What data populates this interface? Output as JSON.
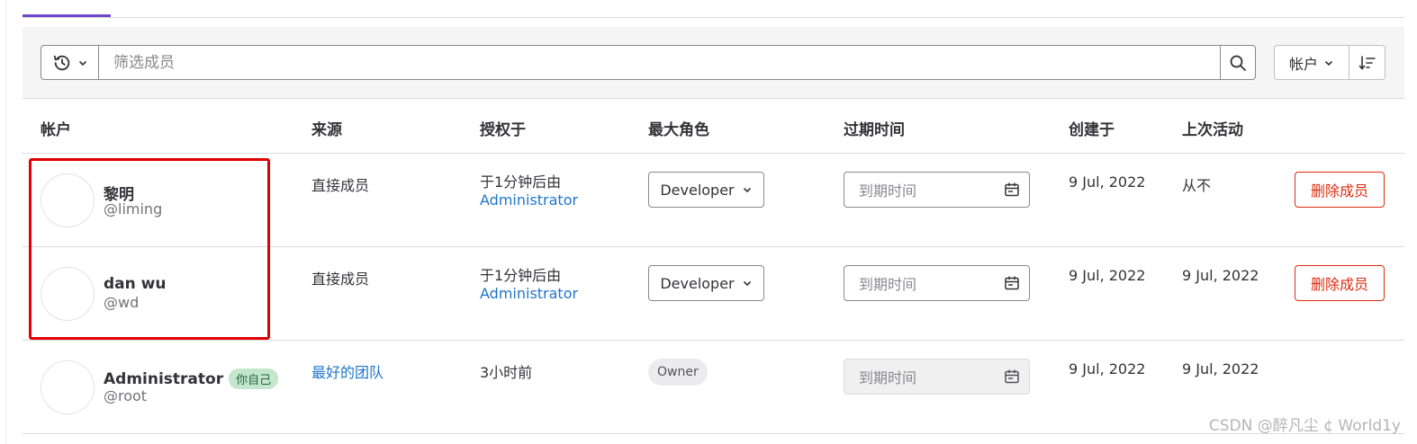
{
  "search": {
    "placeholder": "筛选成员"
  },
  "sort": {
    "field_label": "帐户"
  },
  "columns": {
    "account": "帐户",
    "source": "来源",
    "granted": "授权于",
    "max_role": "最大角色",
    "expiration": "过期时间",
    "created": "创建于",
    "last_activity": "上次活动"
  },
  "members": [
    {
      "name": "黎明",
      "username": "@liming",
      "source": "直接成员",
      "granted_time": "于1分钟后由",
      "granted_by": "Administrator",
      "role": "Developer",
      "expiration_placeholder": "到期时间",
      "created": "9 Jul, 2022",
      "last_activity": "从不",
      "remove_label": "删除成员"
    },
    {
      "name": "dan wu",
      "username": "@wd",
      "source": "直接成员",
      "granted_time": "于1分钟后由",
      "granted_by": "Administrator",
      "role": "Developer",
      "expiration_placeholder": "到期时间",
      "created": "9 Jul, 2022",
      "last_activity": "9 Jul, 2022",
      "remove_label": "删除成员"
    },
    {
      "name": "Administrator",
      "self_badge": "你自己",
      "username": "@root",
      "source": "最好的团队",
      "granted_time": "3小时前",
      "role": "Owner",
      "expiration_placeholder": "到期时间",
      "created": "9 Jul, 2022",
      "last_activity": "9 Jul, 2022"
    }
  ],
  "watermark": "CSDN @醉凡尘 ¢ World1y",
  "colors": {
    "accent": "#6e49cb",
    "link": "#1f75cb",
    "danger": "#dd2b0e",
    "highlight": "#e00000",
    "badge_bg": "#c3e6cd"
  },
  "icons": [
    "history-icon",
    "chevron-down-icon",
    "search-icon",
    "sort-direction-icon",
    "calendar-icon"
  ]
}
